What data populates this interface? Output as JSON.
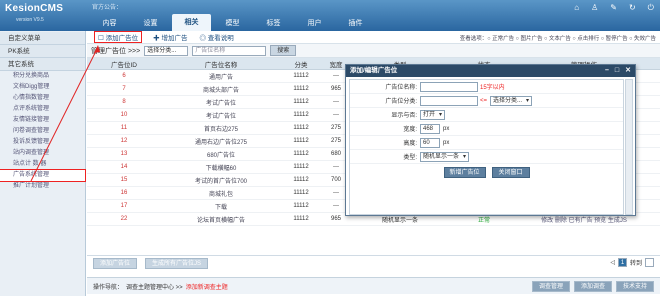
{
  "header": {
    "logo": "KesionCMS",
    "version": "version V9.5",
    "notice": "官方公告：",
    "tabs": [
      "内容",
      "设置",
      "相关",
      "模型",
      "标签",
      "用户",
      "插件"
    ],
    "active_tab": "相关"
  },
  "sidebar": {
    "sections": [
      {
        "label": "自定义菜单",
        "items": []
      },
      {
        "label": "PK系统",
        "items": []
      },
      {
        "label": "其它系统",
        "items": [
          "积分兑换商品",
          "文档Digg管理",
          "心情指数管理",
          "点评系统管理",
          "友情链接管理",
          "问卷调查管理",
          "投诉反馈管理",
          "站内调查管理",
          "站点计 数 器",
          "广告系统管理",
          "推广计划管理"
        ]
      }
    ],
    "selected": "广告系统管理"
  },
  "toolbar": {
    "add_position": "添加广告位",
    "add_ad": "增加广告",
    "view_help": "查看说明",
    "view_options": "查看选项：○ 正常广告 ○ 图片广告 ○ 文本广告 ○ 点击排行 ○ 暂停广告 ○ 失效广告"
  },
  "filter": {
    "label": "管理广告位 >>>",
    "select": "选择分类...",
    "placeholder": "广告位名称",
    "search": "搜索"
  },
  "table": {
    "headers": [
      "广告位ID",
      "广告位名称",
      "分类",
      "宽度",
      "高度",
      "类型",
      "状态",
      "管理操作"
    ],
    "rows": [
      [
        "6",
        "通用广告",
        "11112",
        "---",
        "---",
        "",
        "",
        ""
      ],
      [
        "7",
        "商城头部广告",
        "11112",
        "965",
        "60",
        "",
        "",
        ""
      ],
      [
        "8",
        "考试广告位",
        "11112",
        "---",
        "---",
        "",
        "",
        ""
      ],
      [
        "10",
        "考试广告位",
        "11112",
        "---",
        "---",
        "",
        "",
        ""
      ],
      [
        "11",
        "首页右边275",
        "11112",
        "275",
        "---",
        "",
        "",
        ""
      ],
      [
        "12",
        "通用右边广告位275",
        "11112",
        "275",
        "---",
        "",
        "",
        ""
      ],
      [
        "13",
        "680广告位",
        "11112",
        "680",
        "---",
        "",
        "",
        ""
      ],
      [
        "14",
        "下载横幅60",
        "11112",
        "---",
        "60",
        "",
        "",
        ""
      ],
      [
        "15",
        "考试的首广告位700",
        "11112",
        "700",
        "---",
        "",
        "",
        ""
      ],
      [
        "16",
        "商城礼包",
        "11112",
        "---",
        "---",
        "",
        "",
        ""
      ],
      [
        "17",
        "下载",
        "11112",
        "---",
        "---",
        "随机显示一条",
        "正常",
        "修改 删除 已有广告 预览 生成JS"
      ],
      [
        "22",
        "论坛首页横幅广告",
        "11112",
        "965",
        "60",
        "随机显示一条",
        "正常",
        "修改 删除 已有广告 预览 生成JS"
      ]
    ]
  },
  "footer": {
    "btn_add": "添加广告位",
    "btn_gen": "生成所有广告位JS",
    "pager_label": "转到",
    "page_current": "1",
    "nav_label": "操作导航：",
    "nav_path": "调查主题管理中心 >>",
    "nav_red": "添加新调查主题",
    "btns": [
      "调查管理",
      "添加调查",
      "技术支持"
    ]
  },
  "dialog": {
    "title": "添加/编辑广告位",
    "fields": {
      "name_label": "广告位名称:",
      "name_note": "15字以内",
      "cat_label": "广告位分类:",
      "cat_note": "<=",
      "cat_select": "选择分类...",
      "show_label": "显示与否:",
      "show_value": "打开",
      "width_label": "宽度:",
      "width_value": "468",
      "height_label": "高度:",
      "height_value": "60",
      "px": "px",
      "type_label": "类型:",
      "type_value": "随机显示一条"
    },
    "btn_save": "新增广告位",
    "btn_close": "关闭窗口"
  },
  "colors": {
    "header": "#2f6fa3",
    "dialog_head": "#2c4a67",
    "highlight": "#e22222"
  }
}
